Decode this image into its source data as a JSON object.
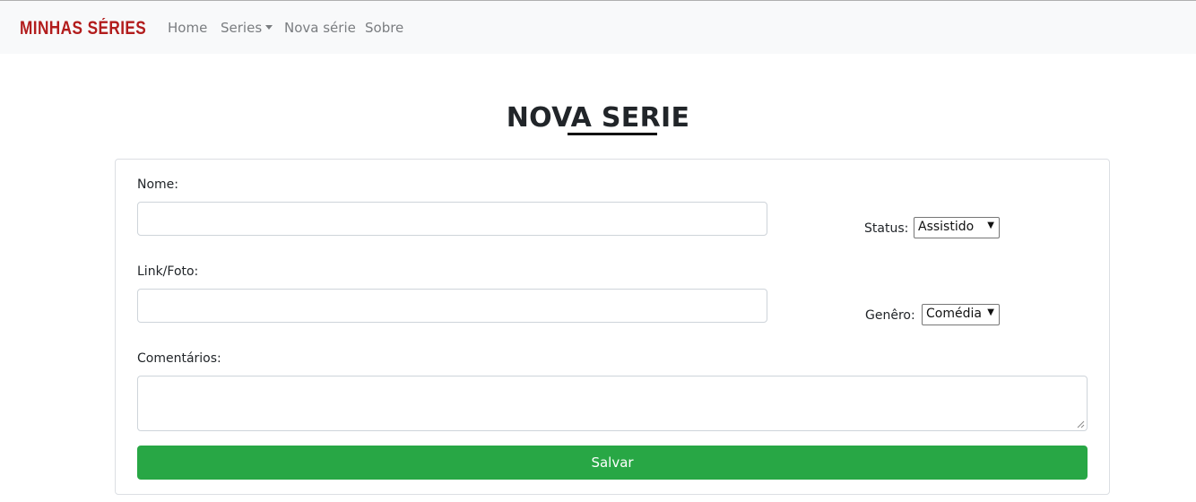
{
  "navbar": {
    "brand": "MINHAS SÉRIES",
    "links": [
      {
        "label": "Home"
      },
      {
        "label": "Series"
      },
      {
        "label": "Nova série"
      },
      {
        "label": "Sobre"
      }
    ]
  },
  "page": {
    "title": "NOVA SERIE"
  },
  "form": {
    "nome_label": "Nome:",
    "nome_value": "",
    "link_label": "Link/Foto:",
    "link_value": "",
    "comentarios_label": "Comentários:",
    "comentarios_value": "",
    "status_label": "Status:",
    "status_value": "Assistido",
    "genero_label": "Genêro:",
    "genero_value": "Comédia",
    "save_label": "Salvar"
  },
  "colors": {
    "brand": "#b21c1c",
    "navbar_bg": "#f8f9fa",
    "save_button": "#28a745"
  },
  "icons": {
    "dropdown": "caret-down-icon",
    "select_arrow": "triangle-down-icon",
    "resize": "resize-grip-icon"
  }
}
